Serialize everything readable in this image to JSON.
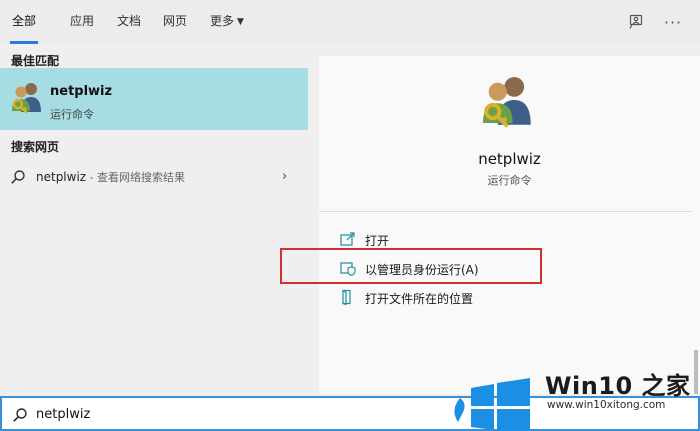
{
  "tabs": [
    {
      "label": "全部",
      "active": true
    },
    {
      "label": "应用",
      "active": false
    },
    {
      "label": "文档",
      "active": false
    },
    {
      "label": "网页",
      "active": false
    },
    {
      "label": "更多",
      "active": false
    }
  ],
  "top_icons": [
    "feedback-icon",
    "more-icon"
  ],
  "more_icon_glyph": "···",
  "left": {
    "best_match_header": "最佳匹配",
    "best_match": {
      "title": "netplwiz",
      "subtitle": "运行命令",
      "icon": "users-key-icon"
    },
    "web_header": "搜索网页",
    "web_result": {
      "term": "netplwiz",
      "suffix": " - 查看网络搜索结果",
      "chevron": "›"
    }
  },
  "right": {
    "app_title": "netplwiz",
    "app_subtitle": "运行命令",
    "actions": [
      {
        "label": "打开",
        "icon": "open-icon"
      },
      {
        "label": "以管理员身份运行(A)",
        "icon": "admin-shield-icon"
      },
      {
        "label": "打开文件所在的位置",
        "icon": "folder-location-icon"
      }
    ]
  },
  "search": {
    "value": "netplwiz"
  },
  "watermark": {
    "brand": "Win10 之家",
    "url": "www.win10xitong.com"
  },
  "colors": {
    "accent": "#2b7bd6",
    "selection": "#a6dde3",
    "highlight": "#d0302f",
    "win_blue": "#1a8fe3"
  }
}
